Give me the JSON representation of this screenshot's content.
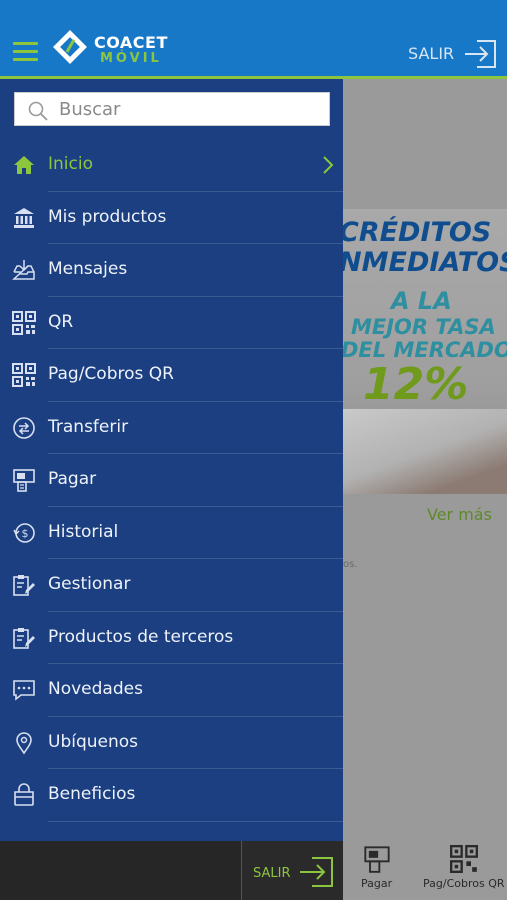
{
  "header": {
    "brand_line1": "COACET",
    "brand_line2": "MÓVIL",
    "logout_label": "SALIR"
  },
  "search": {
    "placeholder": "Buscar"
  },
  "menu": {
    "items": [
      {
        "label": "Inicio",
        "icon": "home-icon",
        "active": true
      },
      {
        "label": "Mis productos",
        "icon": "bank-icon"
      },
      {
        "label": "Mensajes",
        "icon": "inbox-icon"
      },
      {
        "label": "QR",
        "icon": "qr-icon"
      },
      {
        "label": "Pag/Cobros QR",
        "icon": "qr-icon"
      },
      {
        "label": "Transferir",
        "icon": "transfer-icon"
      },
      {
        "label": "Pagar",
        "icon": "pay-icon"
      },
      {
        "label": "Historial",
        "icon": "history-icon"
      },
      {
        "label": "Gestionar",
        "icon": "clipboard-edit-icon"
      },
      {
        "label": "Productos de terceros",
        "icon": "clipboard-edit-icon"
      },
      {
        "label": "Novedades",
        "icon": "chat-icon"
      },
      {
        "label": "Ubíquenos",
        "icon": "location-pin-icon"
      },
      {
        "label": "Beneficios",
        "icon": "shopping-bag-icon"
      }
    ]
  },
  "background": {
    "promo_line1": "CRÉDITOS",
    "promo_line2": "INMEDIATOS",
    "promo_line3": "A LA",
    "promo_line4": "MEJOR TASA",
    "promo_line5": "DEL MERCADO",
    "promo_rate": "12%",
    "see_more": "Ver más",
    "fragment": "os."
  },
  "bottom_bar": {
    "logout_label": "SALIR",
    "tabs": [
      {
        "label": "Pagar",
        "icon": "pay-icon"
      },
      {
        "label": "Pag/Cobros QR",
        "icon": "qr-icon"
      }
    ]
  },
  "colors": {
    "header_blue": "#1878c8",
    "accent_green": "#8cc63f",
    "drawer_blue": "#1b3f80"
  }
}
